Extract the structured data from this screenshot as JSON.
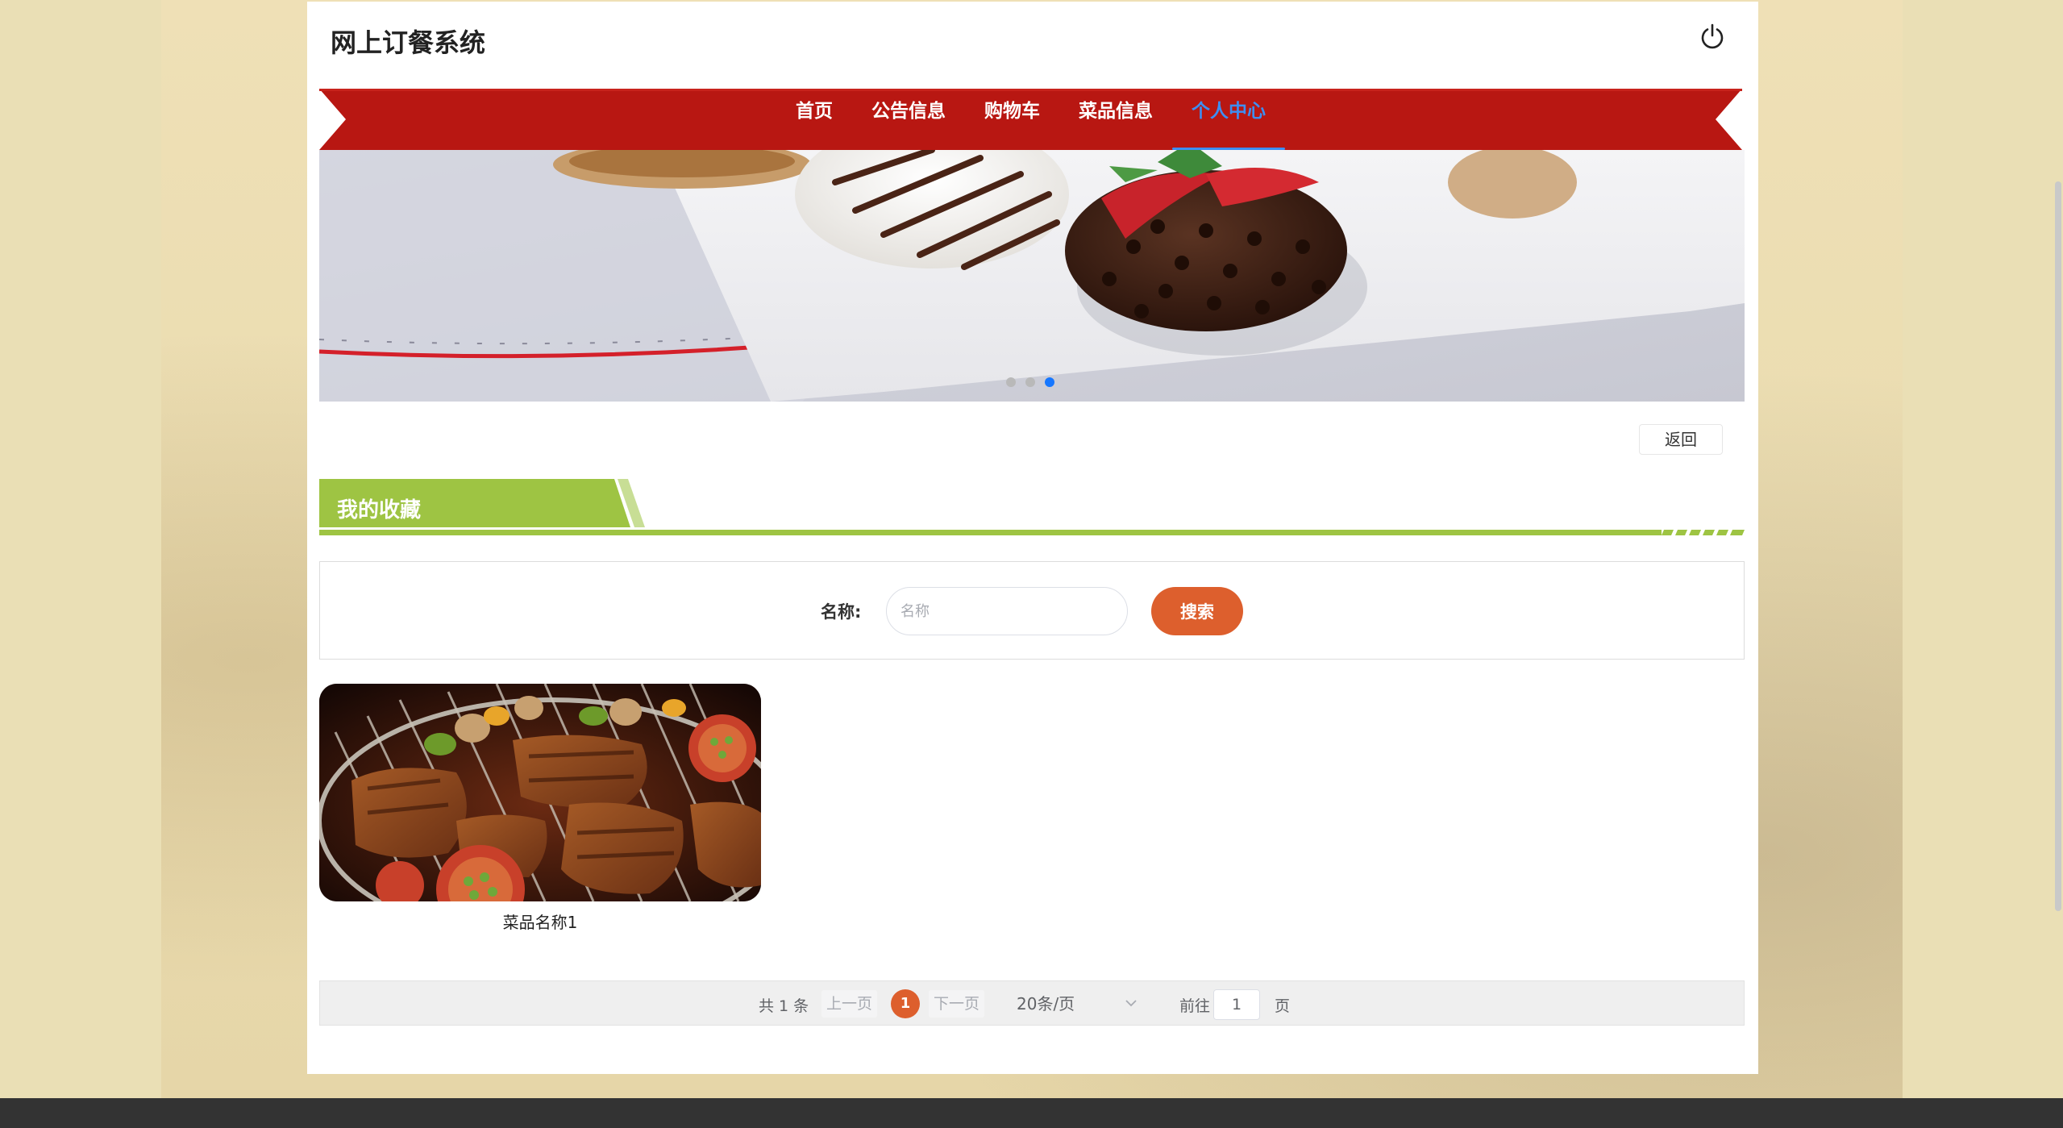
{
  "header": {
    "title": "网上订餐系统",
    "power_icon": "power-icon"
  },
  "nav": {
    "items": [
      {
        "label": "首页"
      },
      {
        "label": "公告信息"
      },
      {
        "label": "购物车"
      },
      {
        "label": "菜品信息"
      },
      {
        "label": "个人中心",
        "active": true
      }
    ]
  },
  "carousel": {
    "slide_count": 3,
    "active_index": 2
  },
  "back_button": "返回",
  "section": {
    "title": "我的收藏"
  },
  "search": {
    "label": "名称:",
    "placeholder": "名称",
    "button": "搜索"
  },
  "favorites": [
    {
      "name": "菜品名称1"
    }
  ],
  "pagination": {
    "total": "共 1 条",
    "prev": "上一页",
    "current": "1",
    "next": "下一页",
    "page_size": "20条/页",
    "goto_label": "前往",
    "goto_value": "1",
    "page_unit": "页"
  },
  "colors": {
    "nav_red": "#b81712",
    "accent_orange": "#dd5f2d",
    "section_green": "#9ec443",
    "active_blue": "#3d8ef2"
  }
}
